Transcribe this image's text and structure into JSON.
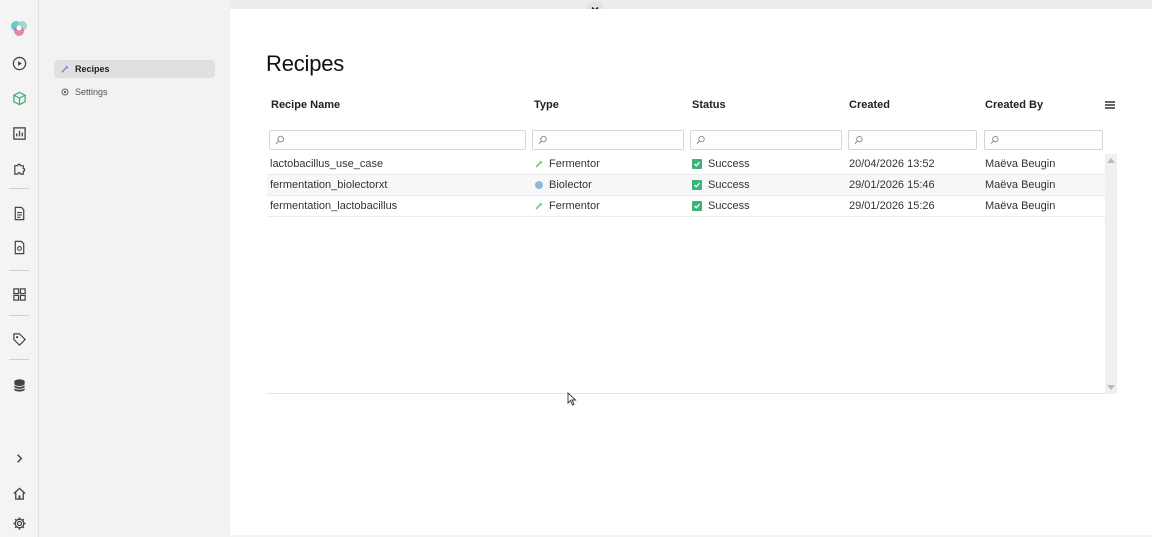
{
  "rail": {
    "items": [
      {
        "name": "app-logo-icon",
        "icon": "flower-logo"
      },
      {
        "name": "run-icon",
        "icon": "play-circle"
      },
      {
        "name": "recipe-cube-icon",
        "icon": "cube"
      },
      {
        "name": "analytics-icon",
        "icon": "bar-chart"
      },
      {
        "name": "plugins-icon",
        "icon": "puzzle"
      },
      {
        "name": "documents-icon",
        "icon": "document"
      },
      {
        "name": "reports-icon",
        "icon": "file-badge"
      },
      {
        "name": "dashboard-icon",
        "icon": "grid"
      },
      {
        "name": "tags-icon",
        "icon": "tag"
      },
      {
        "name": "database-icon",
        "icon": "database"
      },
      {
        "name": "expand-icon",
        "icon": "chevron-right"
      },
      {
        "name": "home-icon",
        "icon": "home"
      },
      {
        "name": "settings-icon",
        "icon": "gear"
      }
    ]
  },
  "subnav": {
    "items": [
      {
        "label": "Recipes",
        "icon": "flask",
        "active": true
      },
      {
        "label": "Settings",
        "icon": "gear",
        "active": false
      }
    ]
  },
  "page": {
    "title": "Recipes"
  },
  "table": {
    "columns": [
      {
        "key": "name",
        "label": "Recipe Name"
      },
      {
        "key": "type",
        "label": "Type"
      },
      {
        "key": "status",
        "label": "Status"
      },
      {
        "key": "created",
        "label": "Created"
      },
      {
        "key": "created_by",
        "label": "Created By"
      }
    ],
    "rows": [
      {
        "name": "lactobacillus_use_case",
        "type": "Fermentor",
        "type_icon": "pipette",
        "status": "Success",
        "created": "20/04/2026 13:52",
        "created_by": "Maëva Beugin"
      },
      {
        "name": "fermentation_biolectorxt",
        "type": "Biolector",
        "type_icon": "dot",
        "status": "Success",
        "created": "29/01/2026 15:46",
        "created_by": "Maëva Beugin"
      },
      {
        "name": "fermentation_lactobacillus",
        "type": "Fermentor",
        "type_icon": "pipette",
        "status": "Success",
        "created": "29/01/2026 15:26",
        "created_by": "Maëva Beugin"
      }
    ]
  },
  "colors": {
    "accent_teal": "#3bb27a",
    "logo_pink": "#e0609a",
    "logo_teal": "#4fc1c7",
    "fermentor_icon": "#7cc576",
    "biolector_icon": "#8fb8e0"
  }
}
